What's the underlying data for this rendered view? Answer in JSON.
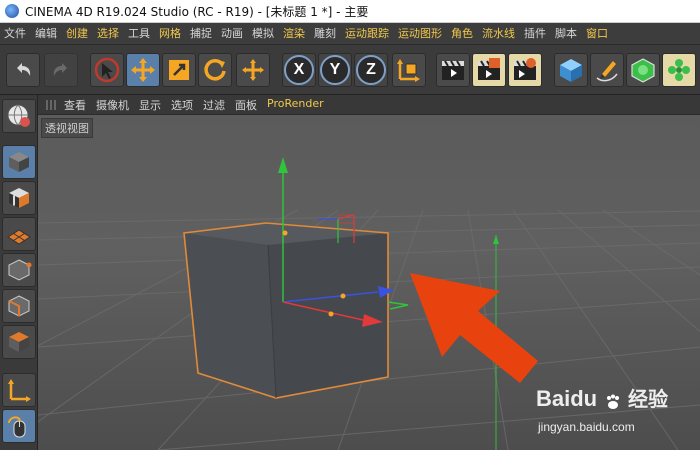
{
  "window": {
    "title": "CINEMA 4D R19.024 Studio (RC - R19) - [未标题 1 *] - 主要"
  },
  "menubar": {
    "items": [
      {
        "label": "文件",
        "accent": false
      },
      {
        "label": "编辑",
        "accent": false
      },
      {
        "label": "创建",
        "accent": true
      },
      {
        "label": "选择",
        "accent": true
      },
      {
        "label": "工具",
        "accent": false
      },
      {
        "label": "网格",
        "accent": true
      },
      {
        "label": "捕捉",
        "accent": false
      },
      {
        "label": "动画",
        "accent": false
      },
      {
        "label": "模拟",
        "accent": false
      },
      {
        "label": "渲染",
        "accent": true
      },
      {
        "label": "雕刻",
        "accent": false
      },
      {
        "label": "运动跟踪",
        "accent": true
      },
      {
        "label": "运动图形",
        "accent": true
      },
      {
        "label": "角色",
        "accent": true
      },
      {
        "label": "流水线",
        "accent": true
      },
      {
        "label": "插件",
        "accent": false
      },
      {
        "label": "脚本",
        "accent": false
      },
      {
        "label": "窗口",
        "accent": true
      }
    ]
  },
  "toolbar": {
    "axis_x": "X",
    "axis_y": "Y",
    "axis_z": "Z"
  },
  "viewport_menu": {
    "items": [
      {
        "label": "查看",
        "highlight": false
      },
      {
        "label": "摄像机",
        "highlight": false
      },
      {
        "label": "显示",
        "highlight": false
      },
      {
        "label": "选项",
        "highlight": false
      },
      {
        "label": "过滤",
        "highlight": false
      },
      {
        "label": "面板",
        "highlight": false
      },
      {
        "label": "ProRender",
        "highlight": true
      }
    ]
  },
  "viewport": {
    "label": "透视视图"
  },
  "watermark": {
    "brand": "Baidu",
    "brand_cn": "经验",
    "url": "jingyan.baidu.com"
  },
  "colors": {
    "accent_menu": "#f2c94c",
    "selection_outline": "#e08a3a",
    "arrow": "#e8430f",
    "axis_x": "#e03a3a",
    "axis_y": "#2fc43a",
    "axis_z": "#3a52e0"
  }
}
